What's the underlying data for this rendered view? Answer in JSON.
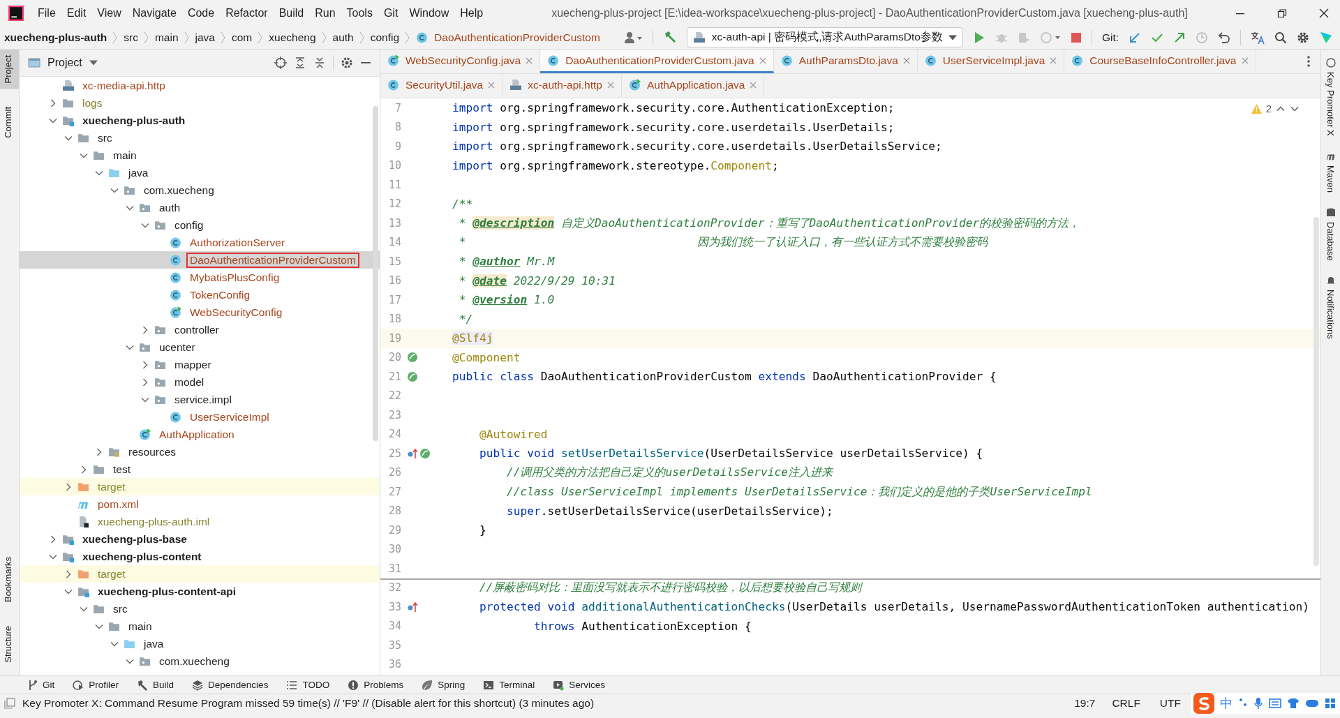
{
  "window": {
    "title": "xuecheng-plus-project [E:\\idea-workspace\\xuecheng-plus-project] - DaoAuthenticationProviderCustom.java [xuecheng-plus-auth]"
  },
  "menu": [
    "File",
    "Edit",
    "View",
    "Navigate",
    "Code",
    "Refactor",
    "Build",
    "Run",
    "Tools",
    "Git",
    "Window",
    "Help"
  ],
  "breadcrumb": [
    {
      "label": "xuecheng-plus-auth",
      "kind": "module"
    },
    {
      "label": "src",
      "kind": "folder"
    },
    {
      "label": "main",
      "kind": "folder"
    },
    {
      "label": "java",
      "kind": "folder"
    },
    {
      "label": "com",
      "kind": "folder"
    },
    {
      "label": "xuecheng",
      "kind": "folder"
    },
    {
      "label": "auth",
      "kind": "folder"
    },
    {
      "label": "config",
      "kind": "folder"
    },
    {
      "label": "DaoAuthenticationProviderCustom",
      "kind": "class"
    }
  ],
  "run_config": {
    "label": "xc-auth-api | 密码模式,请求AuthParamsDto参数"
  },
  "git_label": "Git:",
  "left_stripe": {
    "top": [
      {
        "label": "Project",
        "selected": true
      },
      {
        "label": "Commit",
        "selected": false
      }
    ],
    "bottom": [
      {
        "label": "Bookmarks",
        "selected": false
      },
      {
        "label": "Structure",
        "selected": false
      }
    ]
  },
  "project_panel": {
    "title": "Project",
    "tree": [
      {
        "label": "xc-media-api.http",
        "kind": "http",
        "color": "#a6461c",
        "selected": false,
        "annotated": false
      },
      {
        "label": "logs",
        "kind": "folder",
        "color": "#85852f",
        "expanded": false,
        "selected": false,
        "annotated": false
      },
      {
        "label": "xuecheng-plus-auth",
        "kind": "module",
        "color": "#1e1e1e",
        "expanded": true,
        "selected": false,
        "annotated": false,
        "children": [
          {
            "label": "src",
            "kind": "folder",
            "color": "#1e1e1e",
            "expanded": true,
            "selected": false,
            "annotated": false,
            "children": [
              {
                "label": "main",
                "kind": "folder",
                "color": "#1e1e1e",
                "expanded": true,
                "selected": false,
                "annotated": false,
                "children": [
                  {
                    "label": "java",
                    "kind": "source",
                    "color": "#1e1e1e",
                    "expanded": true,
                    "selected": false,
                    "annotated": false,
                    "children": [
                      {
                        "label": "com.xuecheng",
                        "kind": "package",
                        "color": "#1e1e1e",
                        "expanded": true,
                        "selected": false,
                        "annotated": false,
                        "children": [
                          {
                            "label": "auth",
                            "kind": "package",
                            "color": "#1e1e1e",
                            "expanded": true,
                            "selected": false,
                            "annotated": false,
                            "children": [
                              {
                                "label": "config",
                                "kind": "package",
                                "color": "#1e1e1e",
                                "expanded": true,
                                "selected": false,
                                "annotated": false,
                                "children": [
                                  {
                                    "label": "AuthorizationServer",
                                    "kind": "class",
                                    "color": "#a6461c",
                                    "selected": false,
                                    "annotated": false
                                  },
                                  {
                                    "label": "DaoAuthenticationProviderCustom",
                                    "kind": "class",
                                    "color": "#a6461c",
                                    "selected": true,
                                    "annotated": true
                                  },
                                  {
                                    "label": "MybatisPlusConfig",
                                    "kind": "class",
                                    "color": "#a6461c",
                                    "selected": false,
                                    "annotated": false
                                  },
                                  {
                                    "label": "TokenConfig",
                                    "kind": "class",
                                    "color": "#a6461c",
                                    "selected": false,
                                    "annotated": false
                                  },
                                  {
                                    "label": "WebSecurityConfig",
                                    "kind": "class-run",
                                    "color": "#a6461c",
                                    "selected": false,
                                    "annotated": false
                                  }
                                ]
                              },
                              {
                                "label": "controller",
                                "kind": "package",
                                "color": "#1e1e1e",
                                "expanded": false,
                                "selected": false,
                                "annotated": false
                              }
                            ]
                          },
                          {
                            "label": "ucenter",
                            "kind": "package",
                            "color": "#1e1e1e",
                            "expanded": true,
                            "selected": false,
                            "annotated": false,
                            "children": [
                              {
                                "label": "mapper",
                                "kind": "package",
                                "color": "#1e1e1e",
                                "expanded": false,
                                "selected": false,
                                "annotated": false
                              },
                              {
                                "label": "model",
                                "kind": "package",
                                "color": "#1e1e1e",
                                "expanded": false,
                                "selected": false,
                                "annotated": false
                              },
                              {
                                "label": "service.impl",
                                "kind": "package",
                                "color": "#1e1e1e",
                                "expanded": true,
                                "selected": false,
                                "annotated": false,
                                "children": [
                                  {
                                    "label": "UserServiceImpl",
                                    "kind": "class",
                                    "color": "#a6461c",
                                    "selected": false,
                                    "annotated": false
                                  }
                                ]
                              }
                            ]
                          },
                          {
                            "label": "AuthApplication",
                            "kind": "class-run",
                            "color": "#a6461c",
                            "selected": false,
                            "annotated": false
                          }
                        ]
                      }
                    ]
                  },
                  {
                    "label": "resources",
                    "kind": "resources",
                    "color": "#1e1e1e",
                    "expanded": false,
                    "selected": false,
                    "annotated": false
                  }
                ]
              },
              {
                "label": "test",
                "kind": "folder",
                "color": "#1e1e1e",
                "expanded": false,
                "selected": false,
                "annotated": false
              }
            ]
          },
          {
            "label": "target",
            "kind": "excluded",
            "color": "#85852f",
            "expanded": false,
            "selected": false,
            "annotated": false
          },
          {
            "label": "pom.xml",
            "kind": "maven",
            "color": "#a6461c",
            "selected": false,
            "annotated": false
          },
          {
            "label": "xuecheng-plus-auth.iml",
            "kind": "iml",
            "color": "#85852f",
            "selected": false,
            "annotated": false
          }
        ]
      },
      {
        "label": "xuecheng-plus-base",
        "kind": "module",
        "color": "#1e1e1e",
        "expanded": false,
        "selected": false,
        "annotated": false
      },
      {
        "label": "xuecheng-plus-content",
        "kind": "module",
        "color": "#1e1e1e",
        "expanded": true,
        "selected": false,
        "annotated": false,
        "children": [
          {
            "label": "target",
            "kind": "excluded",
            "color": "#85852f",
            "expanded": false,
            "selected": false,
            "annotated": false
          },
          {
            "label": "xuecheng-plus-content-api",
            "kind": "module",
            "color": "#1e1e1e",
            "expanded": true,
            "selected": false,
            "annotated": false,
            "children": [
              {
                "label": "src",
                "kind": "folder",
                "color": "#1e1e1e",
                "expanded": true,
                "selected": false,
                "annotated": false,
                "children": [
                  {
                    "label": "main",
                    "kind": "folder",
                    "color": "#1e1e1e",
                    "expanded": true,
                    "selected": false,
                    "annotated": false,
                    "children": [
                      {
                        "label": "java",
                        "kind": "source",
                        "color": "#1e1e1e",
                        "expanded": true,
                        "selected": false,
                        "annotated": false,
                        "children": [
                          {
                            "label": "com.xuecheng",
                            "kind": "package",
                            "color": "#1e1e1e",
                            "expanded": true,
                            "selected": false,
                            "annotated": false
                          }
                        ]
                      }
                    ]
                  }
                ]
              }
            ]
          }
        ]
      }
    ]
  },
  "editor_tab_rows": [
    {
      "tabs": [
        {
          "label": "WebSecurityConfig.java",
          "kind": "class-run",
          "selected": false
        },
        {
          "label": "DaoAuthenticationProviderCustom.java",
          "kind": "class",
          "selected": true
        },
        {
          "label": "AuthParamsDto.java",
          "kind": "class",
          "selected": false
        },
        {
          "label": "UserServiceImpl.java",
          "kind": "class",
          "selected": false
        },
        {
          "label": "CourseBaseInfoController.java",
          "kind": "class",
          "selected": false
        }
      ]
    },
    {
      "tabs": [
        {
          "label": "SecurityUtil.java",
          "kind": "class",
          "selected": false
        },
        {
          "label": "xc-auth-api.http",
          "kind": "http",
          "selected": false
        },
        {
          "label": "AuthApplication.java",
          "kind": "class-run",
          "selected": false
        }
      ]
    }
  ],
  "inspections": {
    "warnings": "2"
  },
  "code": [
    {
      "number": "7",
      "current": false,
      "separator": false,
      "tokens": [
        {
          "text": "import",
          "kind": "kw"
        },
        {
          "text": " org.springframework.security.core.AuthenticationException;",
          "kind": "plain"
        }
      ]
    },
    {
      "number": "8",
      "current": false,
      "separator": false,
      "tokens": [
        {
          "text": "import",
          "kind": "kw"
        },
        {
          "text": " org.springframework.security.core.userdetails.UserDetails;",
          "kind": "plain"
        }
      ]
    },
    {
      "number": "9",
      "current": false,
      "separator": false,
      "tokens": [
        {
          "text": "import",
          "kind": "kw"
        },
        {
          "text": " org.springframework.security.core.userdetails.UserDetailsService;",
          "kind": "plain"
        }
      ]
    },
    {
      "number": "10",
      "current": false,
      "separator": false,
      "tokens": [
        {
          "text": "import",
          "kind": "kw"
        },
        {
          "text": " org.springframework.stereotype.",
          "kind": "plain"
        },
        {
          "text": "Component",
          "kind": "ann"
        },
        {
          "text": ";",
          "kind": "plain"
        }
      ]
    },
    {
      "number": "11",
      "current": false,
      "separator": false
    },
    {
      "number": "12",
      "current": false,
      "separator": false,
      "tokens": [
        {
          "text": "/**",
          "kind": "doc"
        }
      ]
    },
    {
      "number": "13",
      "current": false,
      "separator": false,
      "tokens": [
        {
          "text": " * ",
          "kind": "doc"
        },
        {
          "text": "@description",
          "kind": "tag-hl"
        },
        {
          "text": " 自定义DaoAuthenticationProvider：重写了DaoAuthenticationProvider的校验密码的方法，",
          "kind": "doc"
        }
      ]
    },
    {
      "number": "14",
      "current": false,
      "separator": false,
      "tokens": [
        {
          "text": " *                                  因为我们统一了认证入口，有一些认证方式不需要校验密码",
          "kind": "doc"
        }
      ]
    },
    {
      "number": "15",
      "current": false,
      "separator": false,
      "tokens": [
        {
          "text": " * ",
          "kind": "doc"
        },
        {
          "text": "@author",
          "kind": "tag"
        },
        {
          "text": " Mr.M",
          "kind": "doc"
        }
      ]
    },
    {
      "number": "16",
      "current": false,
      "separator": false,
      "tokens": [
        {
          "text": " * ",
          "kind": "doc"
        },
        {
          "text": "@date",
          "kind": "tag-hl"
        },
        {
          "text": " 2022/9/29 10:31",
          "kind": "doc"
        }
      ]
    },
    {
      "number": "17",
      "current": false,
      "separator": false,
      "tokens": [
        {
          "text": " * ",
          "kind": "doc"
        },
        {
          "text": "@version",
          "kind": "tag"
        },
        {
          "text": " 1.0",
          "kind": "doc"
        }
      ]
    },
    {
      "number": "18",
      "current": false,
      "separator": false,
      "tokens": [
        {
          "text": " */",
          "kind": "doc"
        }
      ]
    },
    {
      "number": "19",
      "current": true,
      "separator": false,
      "tokens": [
        {
          "text": "@Slf4j",
          "kind": "ann-hl"
        }
      ]
    },
    {
      "number": "20",
      "current": false,
      "separator": false,
      "gutter": [
        {
          "kind": "bean"
        }
      ],
      "tokens": [
        {
          "text": "@Component",
          "kind": "ann"
        }
      ]
    },
    {
      "number": "21",
      "current": false,
      "separator": false,
      "gutter": [
        {
          "kind": "bean"
        }
      ],
      "tokens": [
        {
          "text": "public class",
          "kind": "kw"
        },
        {
          "text": " DaoAuthenticationProviderCustom ",
          "kind": "plain"
        },
        {
          "text": "extends",
          "kind": "kw"
        },
        {
          "text": " DaoAuthenticationProvider {",
          "kind": "plain"
        }
      ]
    },
    {
      "number": "22",
      "current": false,
      "separator": false
    },
    {
      "number": "23",
      "current": false,
      "separator": false
    },
    {
      "number": "24",
      "current": false,
      "separator": false,
      "tokens": [
        {
          "text": "    @Autowired",
          "kind": "ann"
        }
      ]
    },
    {
      "number": "25",
      "current": false,
      "separator": false,
      "gutter": [
        {
          "kind": "override"
        },
        {
          "kind": "bean"
        }
      ],
      "tokens": [
        {
          "text": "    public void",
          "kind": "kw"
        },
        {
          "text": " setUserDetailsService",
          "kind": "method"
        },
        {
          "text": "(UserDetailsService userDetailsService) {",
          "kind": "plain"
        }
      ]
    },
    {
      "number": "26",
      "current": false,
      "separator": false,
      "tokens": [
        {
          "text": "        //调用父类的方法把自己定义的userDetailsService注入进来",
          "kind": "comment"
        }
      ]
    },
    {
      "number": "27",
      "current": false,
      "separator": false,
      "tokens": [
        {
          "text": "        //class UserServiceImpl implements UserDetailsService：我们定义的是他的子类UserServiceImpl",
          "kind": "comment"
        }
      ]
    },
    {
      "number": "28",
      "current": false,
      "separator": false,
      "tokens": [
        {
          "text": "        super",
          "kind": "kw"
        },
        {
          "text": ".setUserDetailsService(userDetailsService);",
          "kind": "plain"
        }
      ]
    },
    {
      "number": "29",
      "current": false,
      "separator": false,
      "tokens": [
        {
          "text": "    }",
          "kind": "plain"
        }
      ]
    },
    {
      "number": "30",
      "current": false,
      "separator": false
    },
    {
      "number": "31",
      "current": false,
      "separator": false
    },
    {
      "number": "32",
      "current": false,
      "separator": true,
      "tokens": [
        {
          "text": "    //屏蔽密码对比：里面没写就表示不进行密码校验，以后想要校验自己写规则",
          "kind": "comment"
        }
      ]
    },
    {
      "number": "33",
      "current": false,
      "separator": false,
      "gutter": [
        {
          "kind": "override"
        }
      ],
      "tokens": [
        {
          "text": "    protected void",
          "kind": "kw"
        },
        {
          "text": " additionalAuthenticationChecks",
          "kind": "method"
        },
        {
          "text": "(UserDetails userDetails, UsernamePasswordAuthenticationToken authentication)",
          "kind": "plain"
        }
      ]
    },
    {
      "number": "34",
      "current": false,
      "separator": false,
      "tokens": [
        {
          "text": "            throws",
          "kind": "kw"
        },
        {
          "text": " AuthenticationException {",
          "kind": "plain"
        }
      ]
    },
    {
      "number": "35",
      "current": false,
      "separator": false
    },
    {
      "number": "36",
      "current": false,
      "separator": false
    }
  ],
  "right_stripe": [
    {
      "label": "Key Promoter X",
      "kind": "key"
    },
    {
      "label": "Maven",
      "kind": "maven"
    },
    {
      "label": "Database",
      "kind": "database"
    },
    {
      "label": "Notifications",
      "kind": "bell"
    }
  ],
  "tool_buttons": [
    {
      "label": "Git",
      "kind": "git"
    },
    {
      "label": "Profiler",
      "kind": "profiler"
    },
    {
      "label": "Build",
      "kind": "build"
    },
    {
      "label": "Dependencies",
      "kind": "layers"
    },
    {
      "label": "TODO",
      "kind": "list"
    },
    {
      "label": "Problems",
      "kind": "problems"
    },
    {
      "label": "Spring",
      "kind": "spring"
    },
    {
      "label": "Terminal",
      "kind": "terminal"
    },
    {
      "label": "Services",
      "kind": "services"
    }
  ],
  "status_bar": {
    "message": "Key Promoter X: Command Resume Program missed 59 time(s) // 'F9' // (Disable alert for this shortcut) (3 minutes ago)",
    "position": "19:7",
    "line_separator": "CRLF",
    "encoding": "UTF"
  },
  "ime_toolbar": {
    "mode": "中"
  }
}
